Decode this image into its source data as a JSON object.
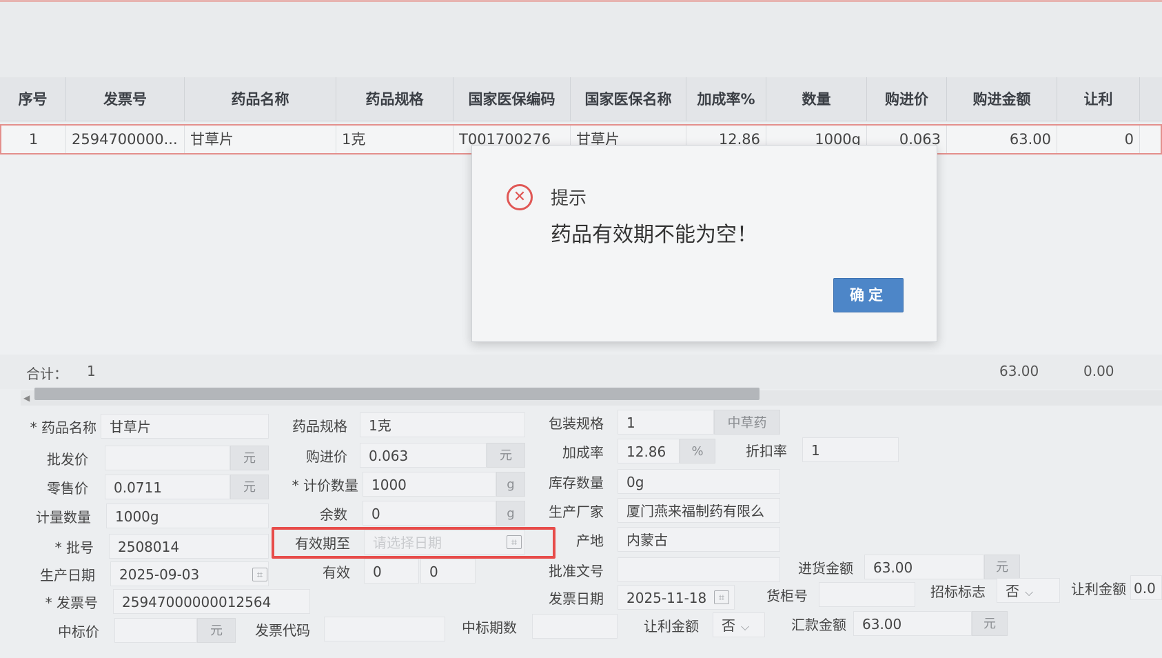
{
  "grid": {
    "headers": [
      "序号",
      "发票号",
      "药品名称",
      "药品规格",
      "国家医保编码",
      "国家医保名称",
      "加成率%",
      "数量",
      "购进价",
      "购进金额",
      "让利"
    ],
    "row": {
      "index": "1",
      "invoice": "2594700000...",
      "drug_name": "甘草片",
      "spec": "1克",
      "insurance_code": "T001700276",
      "insurance_name": "甘草片",
      "markup": "12.86",
      "quantity": "1000g",
      "price": "0.063",
      "amount": "63.00",
      "discount": "0"
    },
    "summary": {
      "label": "合计：",
      "count": "1",
      "amount_total": "63.00",
      "discount_total": "0.00"
    }
  },
  "form": {
    "drug_name": {
      "label": "* 药品名称",
      "value": "甘草片"
    },
    "wholesale": {
      "label": "批发价",
      "value": "",
      "unit": "元"
    },
    "retail": {
      "label": "零售价",
      "value": "0.0711",
      "unit": "元"
    },
    "measure_qty": {
      "label": "计量数量",
      "value": "1000g"
    },
    "batch": {
      "label": "* 批号",
      "value": "2508014"
    },
    "mfg_date": {
      "label": "生产日期",
      "value": "2025-09-03"
    },
    "invoice_no": {
      "label": "* 发票号",
      "value": "25947000000012564"
    },
    "bid_price": {
      "label": "中标价",
      "value": "",
      "unit": "元"
    },
    "spec": {
      "label": "药品规格",
      "value": "1克"
    },
    "purchase_price": {
      "label": "购进价",
      "value": "0.063",
      "unit": "元"
    },
    "price_qty": {
      "label": "* 计价数量",
      "value": "1000",
      "unit": "g"
    },
    "remainder": {
      "label": "余数",
      "value": "0",
      "unit": "g"
    },
    "expiry": {
      "label": "有效期至",
      "placeholder": "请选择日期"
    },
    "valid": {
      "label": "有效",
      "value1": "0",
      "value2": "0"
    },
    "invoice_code": {
      "label": "发票代码",
      "value": ""
    },
    "pack_spec": {
      "label": "包装规格",
      "value": "1",
      "category": "中草药"
    },
    "markup": {
      "label": "加成率",
      "value": "12.86",
      "unit": "%"
    },
    "discount_rate": {
      "label": "折扣率",
      "value": "1"
    },
    "stock_qty": {
      "label": "库存数量",
      "value": "0g"
    },
    "manufacturer": {
      "label": "生产厂家",
      "value": "厦门燕来福制药有限么"
    },
    "origin": {
      "label": "产地",
      "value": "内蒙古"
    },
    "approval_no": {
      "label": "批准文号",
      "value": ""
    },
    "invoice_date": {
      "label": "发票日期",
      "value": "2025-11-18"
    },
    "bid_period": {
      "label": "中标期数",
      "value": ""
    },
    "purchase_amount": {
      "label": "进货金额",
      "value": "63.00",
      "unit": "元"
    },
    "shelf_no": {
      "label": "货柜号",
      "value": ""
    },
    "bid_flag": {
      "label": "招标标志",
      "value": "否"
    },
    "rebate_amount": {
      "label": "让利金额",
      "value": "0.0"
    },
    "rebate_amount2": {
      "label": "让利金额",
      "value": "否"
    },
    "remit_amount": {
      "label": "汇款金额",
      "value": "63.00",
      "unit": "元"
    }
  },
  "dialog": {
    "title": "提示",
    "message": "药品有效期不能为空！",
    "ok_label": "确定",
    "icon": "error-circle-icon"
  },
  "colors": {
    "accent": "#4d86c8",
    "error": "#e05755",
    "highlight": "#e74c4a"
  }
}
